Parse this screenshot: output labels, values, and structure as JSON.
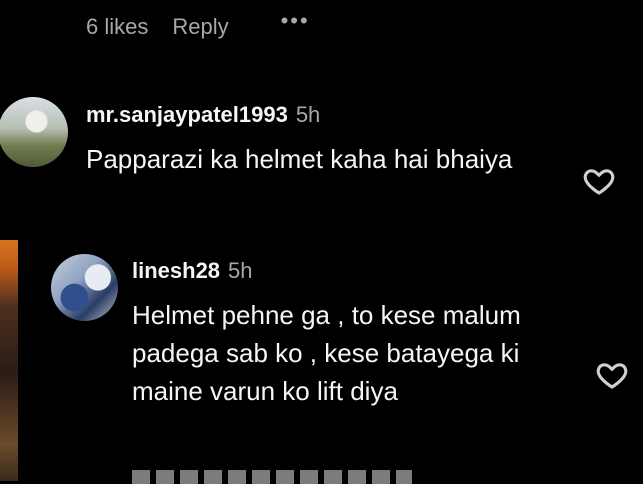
{
  "top": {
    "likes": "6 likes",
    "reply": "Reply",
    "more": "•••"
  },
  "comments": [
    {
      "username": "mr.sanjaypatel1993",
      "time": "5h",
      "text": "Papparazi ka helmet kaha hai bhaiya"
    },
    {
      "username": "linesh28",
      "time": "5h",
      "text": "Helmet pehne ga , to kese malum padega sab ko , kese batayega ki maine varun ko lift diya"
    }
  ],
  "icons": {
    "like": "heart-outline-icon",
    "more": "more-dots-icon"
  },
  "colors": {
    "background": "#000000",
    "text": "#f5f5f5",
    "muted": "#a8a8a8"
  }
}
